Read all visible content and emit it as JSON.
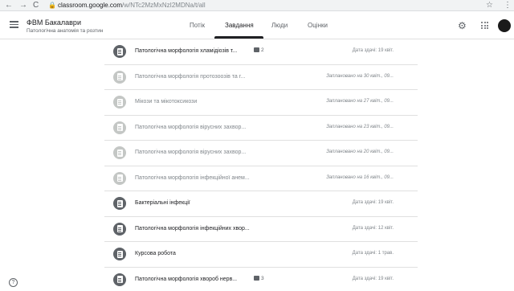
{
  "browser": {
    "back_icon": "←",
    "forward_icon": "→",
    "reload_icon": "C",
    "url_host": "classroom.google.com",
    "url_path": "/w/NTc2MzMxNzI2MDNa/t/all",
    "star_icon": "☆",
    "menu_icon": "⋮"
  },
  "header": {
    "class_title": "ФВМ Бакалаври",
    "class_subtitle": "Патологічна анатомія та розтин",
    "tabs": [
      "Потік",
      "Завдання",
      "Люди",
      "Оцінки"
    ],
    "active_tab": "Завдання",
    "settings_icon": "⚙"
  },
  "assignments": [
    {
      "title": "Патологічна морфологія хламідіозів т...",
      "comments": "2",
      "date": "Дата здачі: 19 квіт.",
      "muted": false
    },
    {
      "title": "Патологічна морфологія протозоозів та г...",
      "comments": "",
      "date": "Заплановано на 30 квіт., 09...",
      "muted": true
    },
    {
      "title": "Мікози та мікотоксикози",
      "comments": "",
      "date": "Заплановано на 27 квіт., 09...",
      "muted": true
    },
    {
      "title": "Патологічна морфологія вірусних захвор...",
      "comments": "",
      "date": "Заплановано на 23 квіт., 09...",
      "muted": true
    },
    {
      "title": "Патологічна морфологія вірусних захвор...",
      "comments": "",
      "date": "Заплановано на 20 квіт., 09...",
      "muted": true
    },
    {
      "title": "Патологічна морфологія інфекційної анем...",
      "comments": "",
      "date": "Заплановано на 16 квіт., 09...",
      "muted": true
    },
    {
      "title": "Бактеріальні інфекції",
      "comments": "",
      "date": "Дата здачі: 19 квіт.",
      "muted": false
    },
    {
      "title": "Патологічна морфологія інфекційних хвор...",
      "comments": "",
      "date": "Дата здачі: 12 квіт.",
      "muted": false
    },
    {
      "title": "Курсова робота",
      "comments": "",
      "date": "Дата здачі: 1 трав.",
      "muted": false
    },
    {
      "title": "Патологічна морфологія хвороб нерв...",
      "comments": "3",
      "date": "Дата здачі: 19 квіт.",
      "muted": false
    }
  ],
  "help_icon": "?"
}
